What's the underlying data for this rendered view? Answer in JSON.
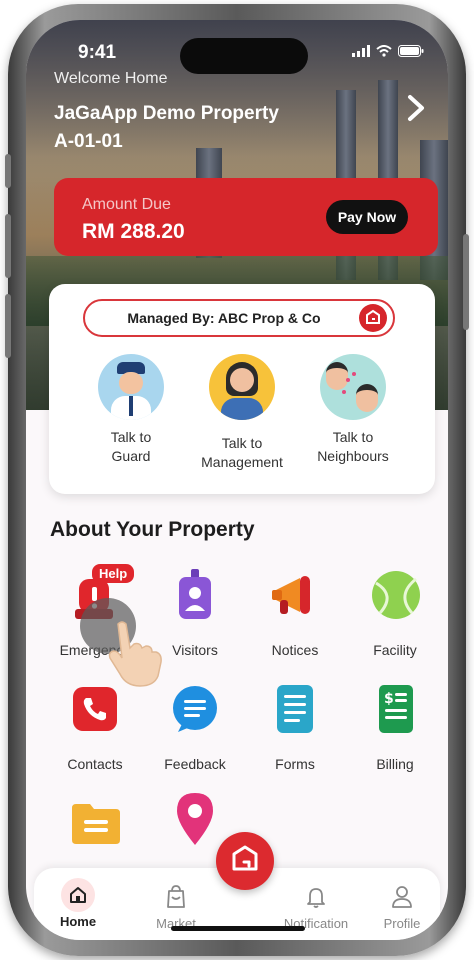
{
  "status_bar": {
    "time": "9:41"
  },
  "header": {
    "welcome": "Welcome Home",
    "property_name": "JaGaApp Demo Property",
    "unit": "A-01-01"
  },
  "amount_due": {
    "label": "Amount Due",
    "value": "RM 288.20",
    "pay_button": "Pay Now",
    "card_color": "#d6262b"
  },
  "managed_by": {
    "label": "Managed By: ABC Prop & Co"
  },
  "talk": [
    {
      "line1": "Talk to",
      "line2": "Guard"
    },
    {
      "line1": "Talk to",
      "line2": "Management"
    },
    {
      "line1": "Talk to",
      "line2": "Neighbours"
    }
  ],
  "about": {
    "title": "About Your Property",
    "help_badge": "Help",
    "tiles": [
      {
        "label": "Emergency",
        "icon": "alarm-icon"
      },
      {
        "label": "Visitors",
        "icon": "visitor-badge-icon"
      },
      {
        "label": "Notices",
        "icon": "megaphone-icon"
      },
      {
        "label": "Facility",
        "icon": "tennis-ball-icon"
      },
      {
        "label": "Contacts",
        "icon": "phone-icon"
      },
      {
        "label": "Feedback",
        "icon": "chat-bubble-icon"
      },
      {
        "label": "Forms",
        "icon": "document-icon"
      },
      {
        "label": "Billing",
        "icon": "bill-icon"
      },
      {
        "label": "",
        "icon": "folder-icon"
      },
      {
        "label": "",
        "icon": "location-pin-icon"
      }
    ]
  },
  "tabbar": {
    "home": "Home",
    "market": "Market",
    "notification": "Notification",
    "profile": "Profile"
  },
  "colors": {
    "brand_red": "#dc2a2f",
    "accent_red": "#d9363b"
  }
}
